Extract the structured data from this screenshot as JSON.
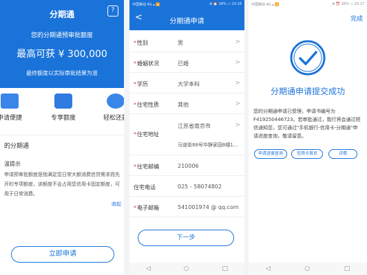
{
  "panel1": {
    "title": "分期通",
    "preapproved_label": "您的分期通预审批额度",
    "max_amount": "最高可获 ¥ 300,000",
    "note": "最终额度以实际审批结果为准",
    "features": [
      "申请便捷",
      "专享额度",
      "轻松还款"
    ],
    "section_title": "的分期通",
    "tip_title": "温提示",
    "tip_text": "申请预审批额度是指满足您日常大额消费信贷需求而先开的专项额度，该额度不会占用您信用卡固定额度，可用于日常消费。",
    "collapse_label": "收起",
    "apply_button": "立即申请",
    "help_icon_text": "?",
    "brand_color": "#1a73d9"
  },
  "panel2": {
    "status_left": "中国移动 4G ▴ 📶",
    "status_right": "⊕ ⏰ 16% ▭ 23:16",
    "back_label": "<",
    "title": "分期通申请",
    "rows": [
      {
        "label": "性别",
        "required": true,
        "value": "男",
        "arrow": ">"
      },
      {
        "label": "婚姻状况",
        "required": true,
        "value": "已婚",
        "arrow": ">"
      },
      {
        "label": "学历",
        "required": true,
        "value": "大学本科",
        "arrow": ">"
      },
      {
        "label": "住宅性质",
        "required": true,
        "value": "其他",
        "arrow": ">"
      },
      {
        "label": "住宅地址",
        "required": true,
        "value": "江苏省南京市",
        "value2": "马道街88号华静家园6幢1...",
        "arrow": ">"
      },
      {
        "label": "住宅邮编",
        "required": true,
        "value": "210006",
        "arrow": ""
      },
      {
        "label": "住宅电话",
        "required": false,
        "value": "025 - 58074802",
        "arrow": ""
      },
      {
        "label": "电子邮箱",
        "required": true,
        "value": "541001974 @ qq.com",
        "arrow": ""
      }
    ],
    "next_button": "下一步",
    "nav": [
      "◁",
      "○",
      "□"
    ]
  },
  "panel3": {
    "status_left": "中国移动 4G ▴ 📶",
    "status_right": "⊕ ⏰ 16% ▭ 23:17",
    "done_label": "完成",
    "title": "分期通申请提交成功",
    "message": "您的分期通申请已受理，申请书编号为F419250446723。若审批通过，我行将会通过短信通知您，您可通过\"手机银行-信用卡-分期通\"申请进度查询，敬请留意。",
    "buttons": [
      "申请进度查询",
      "信用卡首页",
      "详情"
    ],
    "nav": [
      "◁",
      "○",
      "□"
    ]
  }
}
